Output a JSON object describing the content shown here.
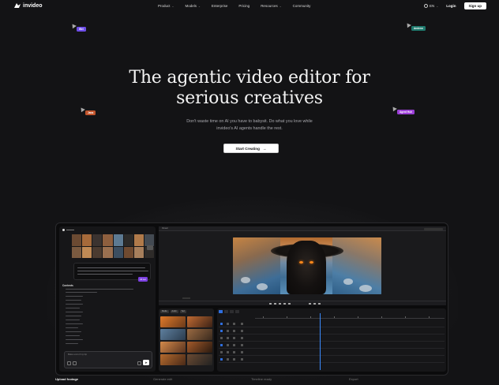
{
  "nav": {
    "brand": "invideo",
    "menu": [
      {
        "label": "Product",
        "has_dropdown": true
      },
      {
        "label": "Models",
        "has_dropdown": true
      },
      {
        "label": "Enterprise",
        "has_dropdown": false
      },
      {
        "label": "Pricing",
        "has_dropdown": false
      },
      {
        "label": "Resources",
        "has_dropdown": true
      },
      {
        "label": "Community",
        "has_dropdown": false
      }
    ],
    "language": "EN",
    "login": "Login",
    "signup": "Sign up"
  },
  "cursor_tags": [
    {
      "label": "Wei",
      "color": "#6d4de8"
    },
    {
      "label": "Andrew",
      "color": "#1f7a6e"
    },
    {
      "label": "Jana",
      "color": "#c2552d"
    },
    {
      "label": "Agent Huh",
      "color": "#9b3fd6"
    }
  ],
  "hero": {
    "title_line1": "The agentic video editor for",
    "title_line2": "serious creatives",
    "subtitle_line1": "Don't waste time on AI you have to babysit. Do what you love while",
    "subtitle_line2": "invideo's AI agents handle the rest.",
    "cta_label": "Start Creating",
    "cta_arrow": "→"
  },
  "app": {
    "viewer_tab": "Viewer",
    "chat_badge": "Alt set",
    "panel_title": "Contents",
    "input_placeholder": "Make a cut of my trip",
    "media_tabs": [
      "Media",
      "Audio",
      "Text"
    ]
  },
  "features": [
    {
      "label": "Upload footage",
      "active": true
    },
    {
      "label": "Generate edit",
      "active": false
    },
    {
      "label": "Timeline ready",
      "active": false
    },
    {
      "label": "Export",
      "active": false
    }
  ],
  "colors": {
    "background": "#131315",
    "accent_blue": "#3a8bff",
    "accent_purple": "#7b3fe0"
  }
}
